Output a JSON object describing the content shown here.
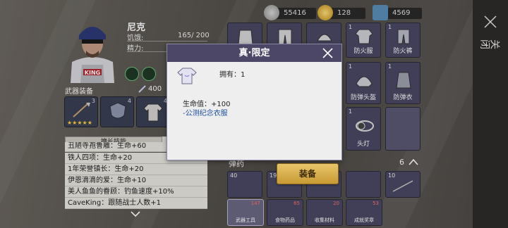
{
  "resources": [
    {
      "icon": "coin-stack-icon",
      "value": "55416"
    },
    {
      "icon": "gold-coin-icon",
      "value": "128"
    },
    {
      "icon": "ticket-icon",
      "value": "4569"
    }
  ],
  "sidebar": {
    "close_label": "关闭"
  },
  "character": {
    "name": "尼克",
    "hunger_label": "饥饿:",
    "hunger_value": "165/ 200",
    "spirit_label": "精力:",
    "avatar_text": "KING"
  },
  "weapon_section": {
    "title": "武器装备",
    "power": "400",
    "slots": [
      {
        "num": "3",
        "stars": "★★★★★"
      },
      {
        "num": "4",
        "stars": ""
      },
      {
        "num": "4",
        "stars": ""
      }
    ]
  },
  "skills": {
    "tab_label": "擅长技能",
    "tab2_label": "",
    "rows": [
      "丑陋寺孢鲁雕：生命+60",
      "铁人四项：生命+20",
      "1年荣誉镇长：生命+20",
      "伊恩滴滴的爱：生命+10",
      "美人鱼鱼的眷顾：钓鱼速度+10%",
      "CaveKing：跟随战士人数+1"
    ]
  },
  "inventory": {
    "items": [
      {
        "n": "",
        "label": ""
      },
      {
        "n": "",
        "label": ""
      },
      {
        "n": "",
        "label": ""
      },
      {
        "n": "1",
        "label": "防火服"
      },
      {
        "n": "1",
        "label": "防火裤"
      },
      {
        "n": "1",
        "label": "防弹头盔"
      },
      {
        "n": "1",
        "label": "防弹衣"
      },
      {
        "n": "1",
        "label": "头灯"
      }
    ],
    "ammo_title": "弹药",
    "ammo_count": "6",
    "ammo": [
      "40",
      "199",
      "",
      "",
      "10"
    ],
    "categories": [
      {
        "label": "武器工具",
        "badge": "147"
      },
      {
        "label": "食物药品",
        "badge": "65"
      },
      {
        "label": "收集材料",
        "badge": "20"
      },
      {
        "label": "成就奖章",
        "badge": "53"
      }
    ]
  },
  "modal": {
    "title": "真·限定",
    "own_text": "拥有：1",
    "hp_text": "生命值：+100",
    "desc_text": "-公测纪念衣服",
    "equip_label": "装备"
  },
  "colors": {
    "accent_gold": "#d8b04d",
    "modal_header": "#4c4766",
    "desc_blue": "#1c4d9c"
  }
}
